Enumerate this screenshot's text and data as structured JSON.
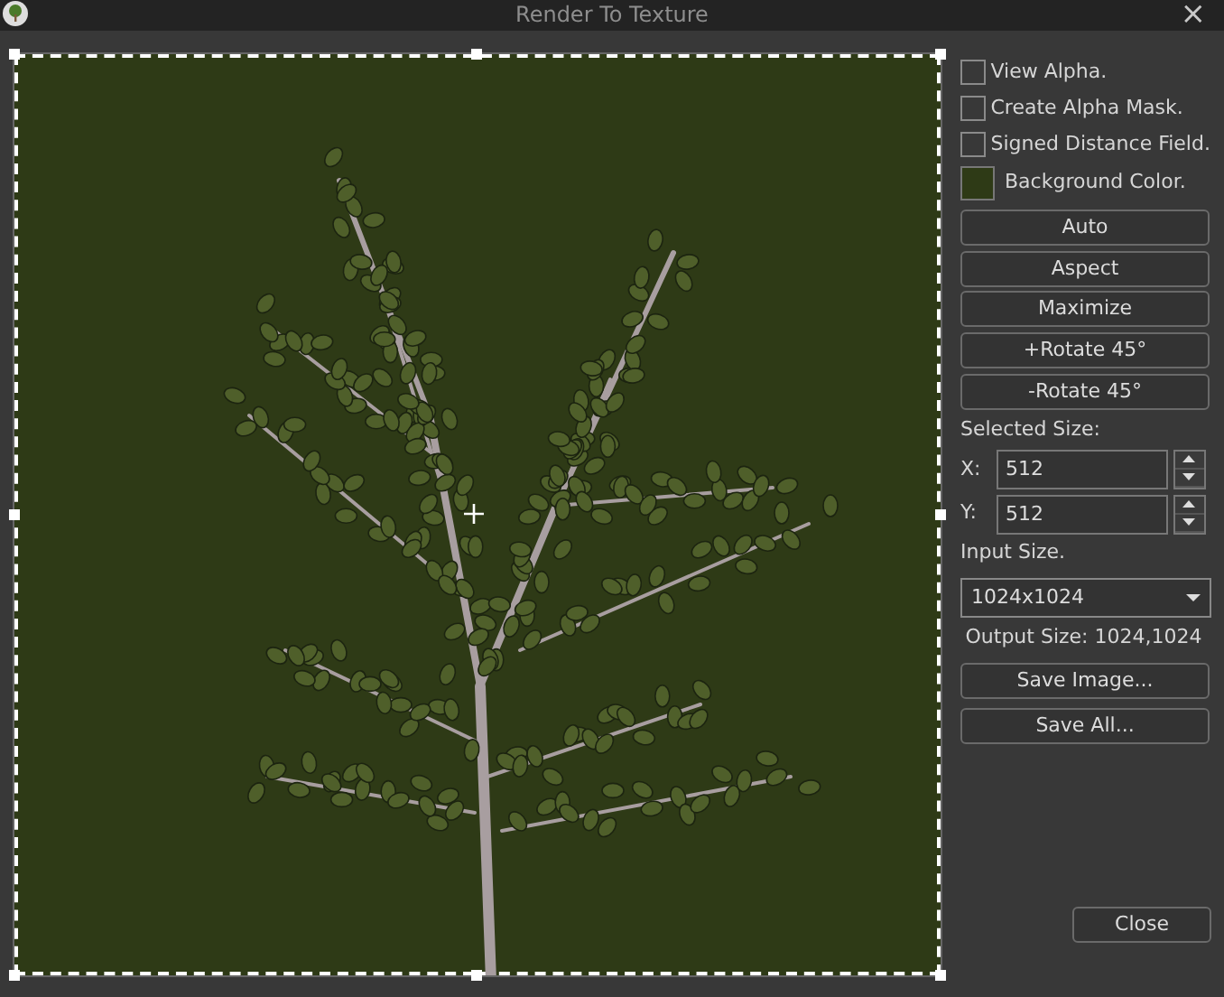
{
  "window": {
    "title": "Render To Texture",
    "close_glyph": "×"
  },
  "options": [
    {
      "label": "View Alpha.",
      "checked": false
    },
    {
      "label": "Create Alpha Mask.",
      "checked": false
    },
    {
      "label": "Signed Distance Field.",
      "checked": false
    }
  ],
  "background_color": {
    "label": "Background Color.",
    "color": "#2e3a16"
  },
  "buttons": [
    "Auto",
    "Aspect",
    "Maximize",
    "+Rotate 45°",
    "-Rotate 45°"
  ],
  "selected_size": {
    "label": "Selected Size:",
    "fields": [
      {
        "label": "X:",
        "value": "512"
      },
      {
        "label": "Y:",
        "value": "512"
      }
    ]
  },
  "input_size": {
    "label": "Input Size.",
    "value": "1024x1024"
  },
  "output_size": "Output Size: 1024,1024",
  "save_buttons": [
    "Save Image...",
    "Save All..."
  ],
  "close_button": "Close"
}
